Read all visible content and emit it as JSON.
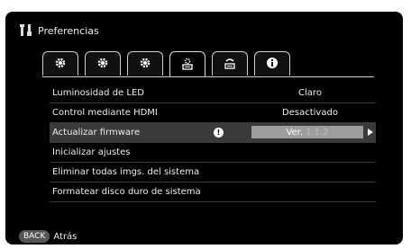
{
  "header": {
    "title": "Preferencias",
    "icon": "preferences-icon"
  },
  "tabs": [
    {
      "icon": "gear-icon",
      "active": false
    },
    {
      "icon": "gear-icon",
      "active": false
    },
    {
      "icon": "gear-icon",
      "active": false
    },
    {
      "icon": "system-settings-icon",
      "active": true
    },
    {
      "icon": "network-icon",
      "active": false
    },
    {
      "icon": "info-icon",
      "active": false
    }
  ],
  "menu": {
    "items": [
      {
        "label": "Luminosidad de LED",
        "value": "Claro"
      },
      {
        "label": "Control mediante HDMI",
        "value": "Desactivado"
      },
      {
        "label": "Actualizar firmware",
        "value_prefix": "Ver.",
        "value_number": "1.1.2",
        "alert_icon": "!"
      },
      {
        "label": "Inicializar ajustes"
      },
      {
        "label": "Eliminar todas imgs. del sistema"
      },
      {
        "label": "Formatear disco duro de sistema"
      }
    ]
  },
  "footer": {
    "back_button": "BACK",
    "back_label": "Atrás"
  },
  "colors": {
    "background": "#000000",
    "selected_row": "#3a3a3a",
    "value_box": "#9d9d9d"
  }
}
